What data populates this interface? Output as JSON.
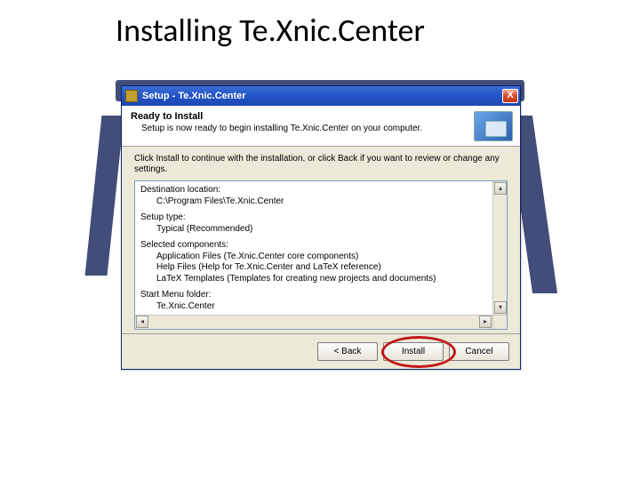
{
  "slide": {
    "title": "Installing Te.Xnic.Center"
  },
  "window": {
    "title_prefix": "Setup - ",
    "title_app": "Te.Xnic.Center",
    "close": "X"
  },
  "header": {
    "title": "Ready to Install",
    "subtitle": "Setup is now ready to begin installing Te.Xnic.Center on your computer."
  },
  "content": {
    "instruction": "Click Install to continue with the installation, or click Back if you want to review or change any settings.",
    "sections": [
      {
        "label": "Destination location:",
        "value": "C:\\Program Files\\Te.Xnic.Center"
      },
      {
        "label": "Setup type:",
        "value": "Typical (Recommended)"
      },
      {
        "label": "Selected components:",
        "value": "Application Files (Te.Xnic.Center core components)\nHelp Files (Help for Te.Xnic.Center and LaTeX reference)\nLaTeX Templates (Templates for creating new projects and documents)"
      },
      {
        "label": "Start Menu folder:",
        "value": "Te.Xnic.Center"
      }
    ]
  },
  "buttons": {
    "back": "< Back",
    "install": "Install",
    "cancel": "Cancel"
  }
}
